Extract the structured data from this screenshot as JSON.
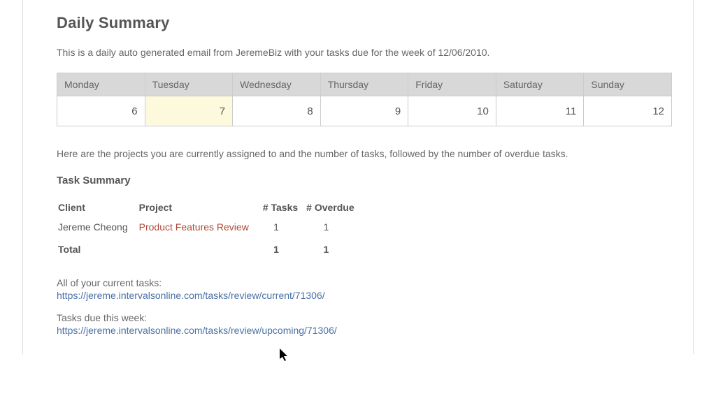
{
  "header": {
    "title": "Daily Summary",
    "intro": "This is a daily auto generated email from JeremeBiz with your tasks due for the week of 12/06/2010."
  },
  "week": {
    "days": [
      {
        "name": "Monday",
        "num": "6",
        "highlight": false
      },
      {
        "name": "Tuesday",
        "num": "7",
        "highlight": true
      },
      {
        "name": "Wednesday",
        "num": "8",
        "highlight": false
      },
      {
        "name": "Thursday",
        "num": "9",
        "highlight": false
      },
      {
        "name": "Friday",
        "num": "10",
        "highlight": false
      },
      {
        "name": "Saturday",
        "num": "11",
        "highlight": false
      },
      {
        "name": "Sunday",
        "num": "12",
        "highlight": false
      }
    ]
  },
  "projects_intro": "Here are the projects you are currently assigned to and the number of tasks, followed by the number of overdue tasks.",
  "task_summary": {
    "heading": "Task Summary",
    "columns": {
      "client": "Client",
      "project": "Project",
      "tasks": "# Tasks",
      "overdue": "# Overdue"
    },
    "rows": [
      {
        "client": "Jereme Cheong",
        "project": "Product Features Review",
        "tasks": "1",
        "overdue": "1"
      }
    ],
    "total": {
      "label": "Total",
      "tasks": "1",
      "overdue": "1"
    }
  },
  "links": {
    "current": {
      "label": "All of your current tasks:",
      "url": "https://jereme.intervalsonline.com/tasks/review/current/71306/"
    },
    "upcoming": {
      "label": "Tasks due this week:",
      "url": "https://jereme.intervalsonline.com/tasks/review/upcoming/71306/"
    }
  }
}
